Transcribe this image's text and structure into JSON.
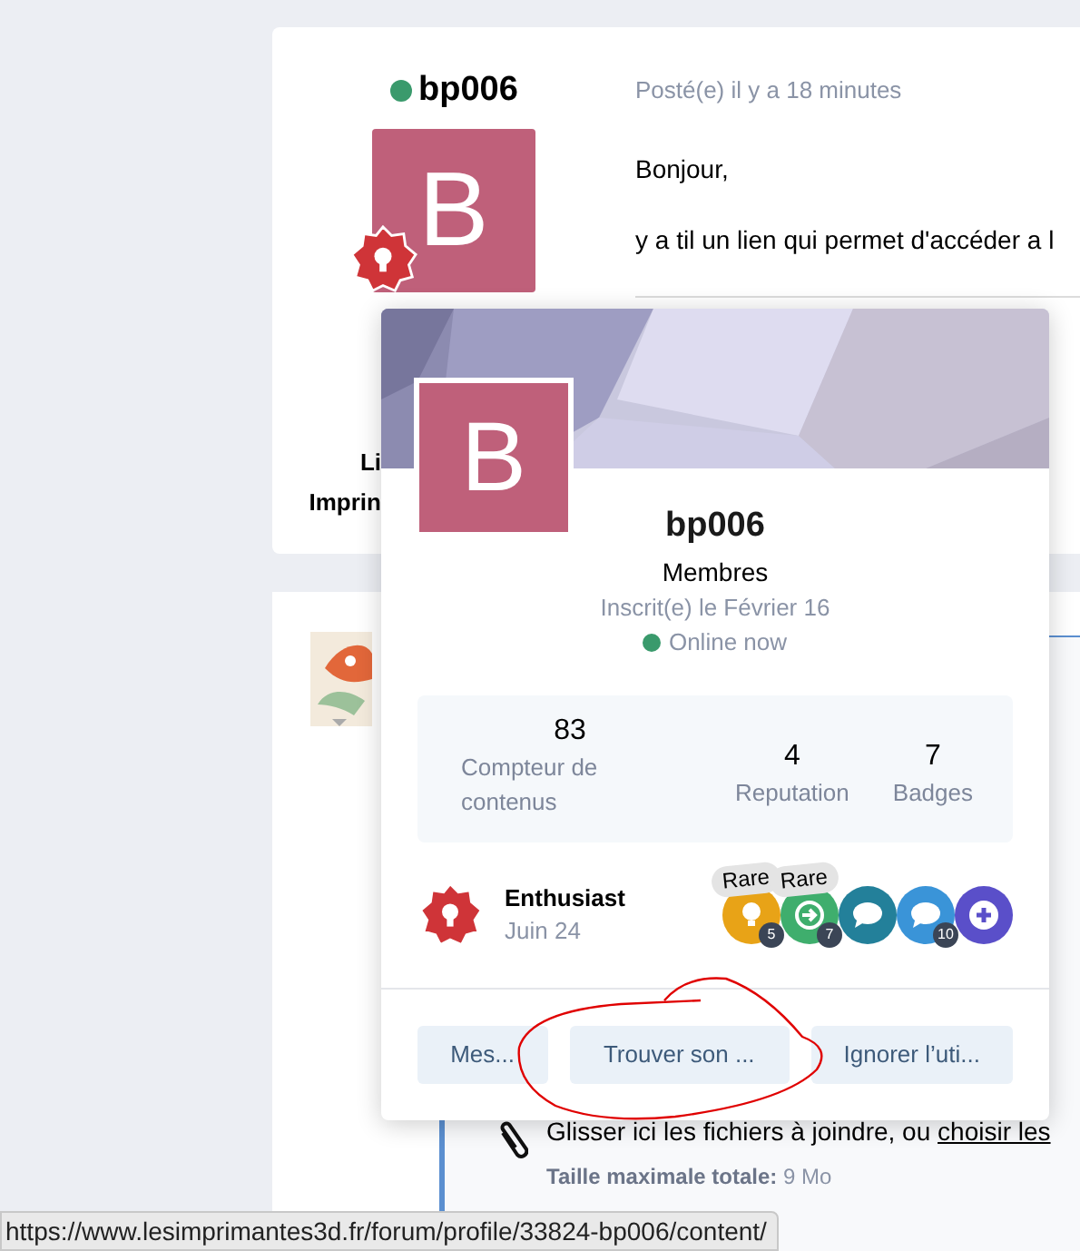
{
  "post": {
    "author": {
      "name": "bp006",
      "online": true,
      "avatar_letter": "B",
      "rank_lines": [
        "Li",
        "Imprin"
      ]
    },
    "meta": "Posté(e) il y a 18 minutes",
    "paragraphs": [
      "Bonjour,",
      "y a til un lien qui permet d'accéder a l"
    ]
  },
  "reply": {
    "upload_text": "Glisser ici les fichiers à joindre, ou",
    "upload_link": "choisir les",
    "size_label": "Taille maximale totale:",
    "size_value": "9 Mo"
  },
  "profile_card": {
    "avatar_letter": "B",
    "name": "bp006",
    "group": "Membres",
    "joined": "Inscrit(e) le Février 16",
    "status": "Online now",
    "online": true,
    "stats": [
      {
        "value": "83",
        "label": "Compteur de contenus"
      },
      {
        "value": "4",
        "label": "Reputation"
      },
      {
        "value": "7",
        "label": "Badges"
      }
    ],
    "rank": {
      "title": "Enthusiast",
      "date": "Juin 24"
    },
    "badges": [
      {
        "kind": "bulb",
        "color": "#e8a317",
        "count": "5",
        "tag": "Rare"
      },
      {
        "kind": "arrow",
        "color": "#3fae6d",
        "count": "7",
        "tag": "Rare"
      },
      {
        "kind": "chat",
        "color": "#23809a"
      },
      {
        "kind": "chat",
        "color": "#3a94d8",
        "count": "10"
      },
      {
        "kind": "plus",
        "color": "#5a4fc9"
      }
    ],
    "buttons": [
      "Mes...",
      "Trouver son ...",
      "Ignorer l’uti..."
    ]
  },
  "status_bar": {
    "url": "https://www.lesimprimantes3d.fr/forum/profile/33824-bp006/content/"
  }
}
